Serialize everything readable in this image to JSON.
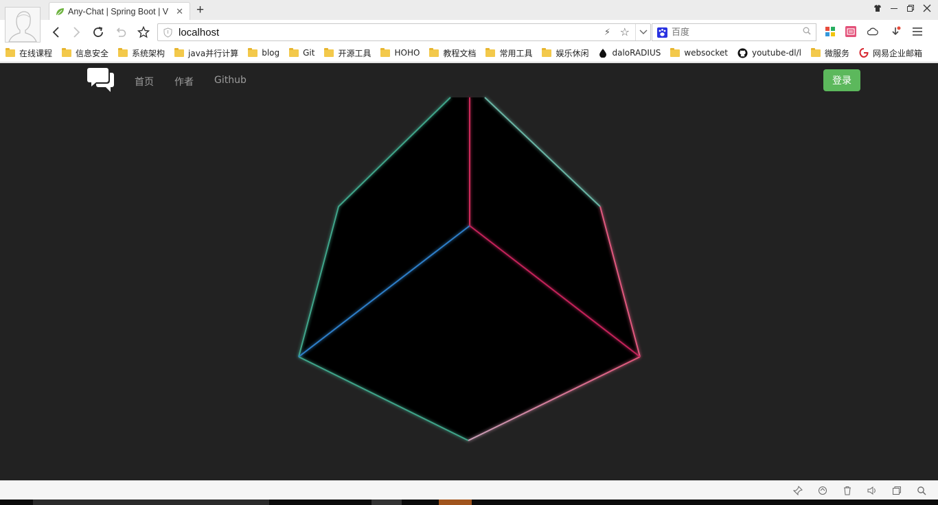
{
  "browser": {
    "tab_title": "Any-Chat | Spring Boot | V",
    "address": "localhost",
    "search_placeholder": "百度",
    "bookmarks": [
      {
        "label": "在线课程",
        "kind": "folder"
      },
      {
        "label": "信息安全",
        "kind": "folder"
      },
      {
        "label": "系统架构",
        "kind": "folder"
      },
      {
        "label": "java并行计算",
        "kind": "folder"
      },
      {
        "label": "blog",
        "kind": "folder"
      },
      {
        "label": "Git",
        "kind": "folder"
      },
      {
        "label": "开源工具",
        "kind": "folder"
      },
      {
        "label": "HOHO",
        "kind": "folder"
      },
      {
        "label": "教程文档",
        "kind": "folder"
      },
      {
        "label": "常用工具",
        "kind": "folder"
      },
      {
        "label": "娱乐休闲",
        "kind": "folder"
      },
      {
        "label": "daloRADIUS",
        "kind": "drop-icon"
      },
      {
        "label": "websocket",
        "kind": "folder"
      },
      {
        "label": "youtube-dl/l",
        "kind": "github-icon"
      },
      {
        "label": "微服务",
        "kind": "folder"
      },
      {
        "label": "网易企业邮箱",
        "kind": "netease-icon"
      }
    ]
  },
  "site": {
    "nav": {
      "home": "首页",
      "author": "作者",
      "github": "Github",
      "login": "登录"
    },
    "colors": {
      "background": "#222222",
      "login_button": "#5cb85c",
      "nav_link": "#9d9d9d"
    }
  },
  "icons": {
    "back": "back-arrow-icon",
    "forward": "forward-arrow-icon",
    "reload": "reload-icon",
    "undo": "undo-icon",
    "star": "star-icon",
    "logo": "chat-bubbles-icon"
  }
}
